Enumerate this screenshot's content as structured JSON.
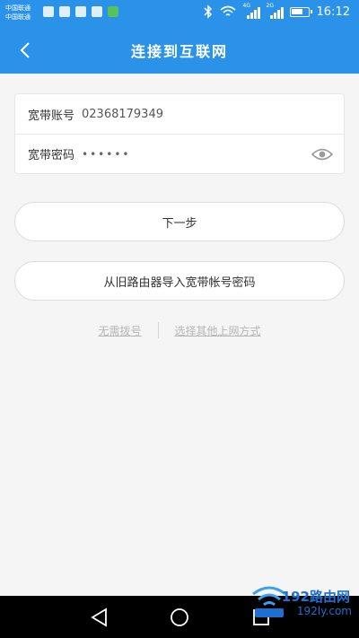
{
  "status_bar": {
    "carrier_line1": "中国联通",
    "carrier_line2": "中国联通",
    "network_1": "4G",
    "network_2": "2G",
    "time": "16:12"
  },
  "header": {
    "title": "连接到互联网"
  },
  "form": {
    "account": {
      "label": "宽带账号",
      "value": "02368179349"
    },
    "password": {
      "label": "宽带密码",
      "value": "••••••"
    }
  },
  "buttons": {
    "next": "下一步",
    "import": "从旧路由器导入宽带帐号密码"
  },
  "links": {
    "no_dialup": "无需拨号",
    "other_method": "选择其他上网方式"
  },
  "watermark": {
    "text": "192路由网",
    "url": "192ly.com"
  },
  "colors": {
    "accent": "#2a93e9",
    "background": "#f5f5f5",
    "link_gray": "#b5b5b5"
  }
}
